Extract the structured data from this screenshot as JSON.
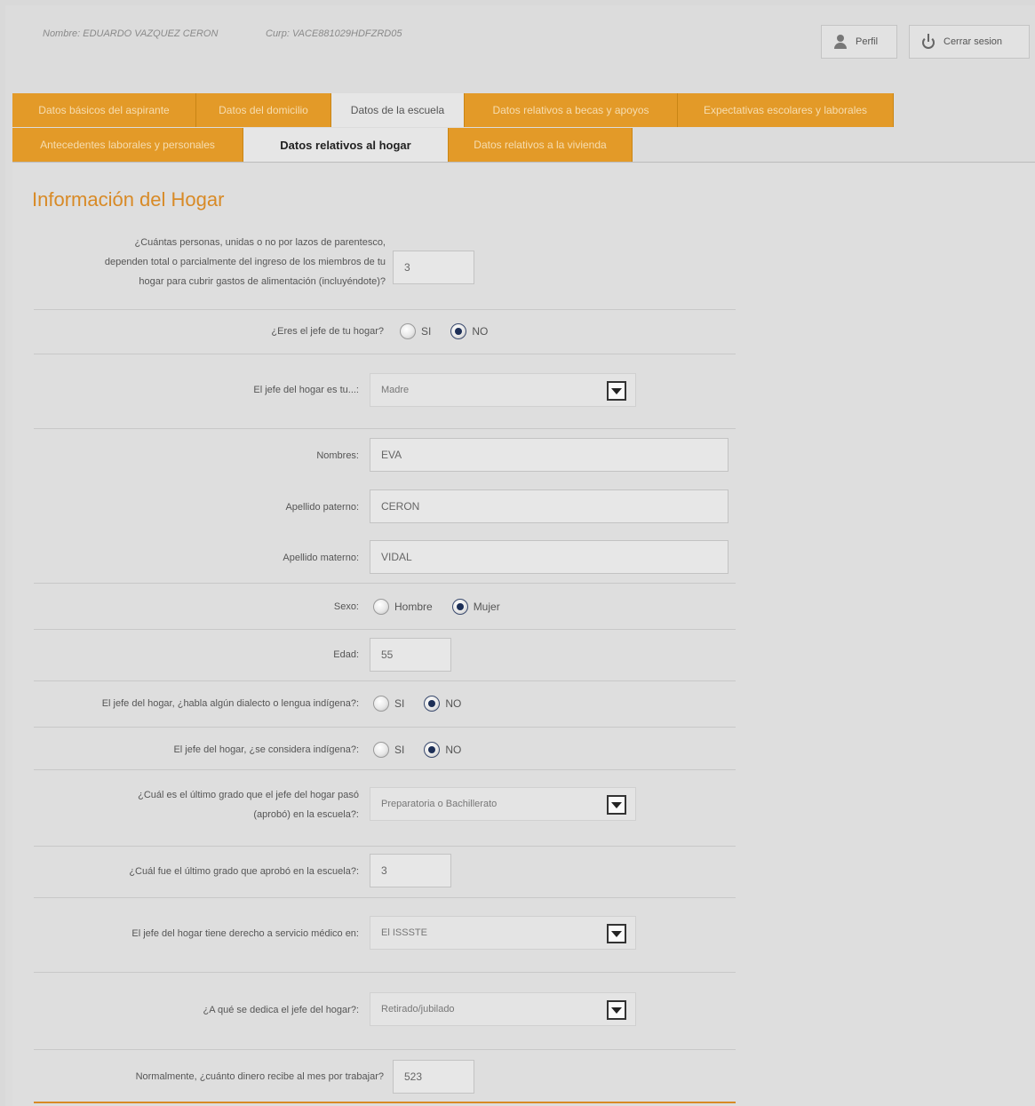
{
  "header": {
    "user": "Nombre: EDUARDO VAZQUEZ CERON",
    "curp": "Curp: VACE881029HDFZRD05",
    "perfil_label": "Perfil",
    "logout_label": "Cerrar sesion"
  },
  "tabs": {
    "row1": [
      "Datos básicos del aspirante",
      "Datos del domicilio",
      "Datos de la escuela",
      "Datos relativos a becas y apoyos",
      "Expectativas escolares y laborales"
    ],
    "row2": [
      "Antecedentes laborales y personales",
      "Datos relativos al hogar",
      "Datos relativos a la vivienda"
    ],
    "selected": "Datos relativos al hogar"
  },
  "form": {
    "title": "Información del Hogar",
    "q_personas": {
      "label_lines": [
        "¿Cuántas personas, unidas o no por lazos de parentesco,",
        "dependen total o parcialmente del ingreso de los miembros de tu",
        "hogar para cubrir gastos de alimentación (incluyéndote)?"
      ],
      "value": "3"
    },
    "q_jefe": {
      "label": "¿Eres el jefe de tu hogar?",
      "opt_si": "SI",
      "opt_no": "NO",
      "selected": "NO"
    },
    "q_parentesco": {
      "label": "El jefe del hogar es tu...:",
      "value": "Madre"
    },
    "nombres": {
      "label": "Nombres:",
      "value": "EVA"
    },
    "ap_paterno": {
      "label": "Apellido paterno:",
      "value": "CERON"
    },
    "ap_materno": {
      "label": "Apellido materno:",
      "value": "VIDAL"
    },
    "sexo": {
      "label": "Sexo:",
      "opt_hombre": "Hombre",
      "opt_mujer": "Mujer",
      "selected": "Mujer"
    },
    "edad": {
      "label": "Edad:",
      "value": "55"
    },
    "q_lengua": {
      "label": "El jefe del hogar, ¿habla algún dialecto o lengua indígena?:",
      "opt_si": "SI",
      "opt_no": "NO",
      "selected": "NO"
    },
    "q_indigena": {
      "label": "El jefe del hogar, ¿se considera indígena?:",
      "opt_si": "SI",
      "opt_no": "NO",
      "selected": "NO"
    },
    "q_grado": {
      "label_lines": [
        "¿Cuál es el último grado que el jefe del hogar pasó",
        "(aprobó) en la escuela?:"
      ],
      "value": "Preparatoria o Bachillerato"
    },
    "q_ultimo": {
      "label": "¿Cuál fue el último grado que aprobó en la escuela?:",
      "value": "3"
    },
    "q_servicio": {
      "label": "El jefe del hogar tiene derecho a servicio médico en:",
      "value": "El ISSSTE"
    },
    "q_dedica": {
      "label": "¿A qué se dedica el jefe del hogar?:",
      "value": "Retirado/jubilado"
    },
    "q_dinero": {
      "label": "Normalmente, ¿cuánto dinero recibe al mes por trabajar?",
      "value": "523"
    }
  }
}
